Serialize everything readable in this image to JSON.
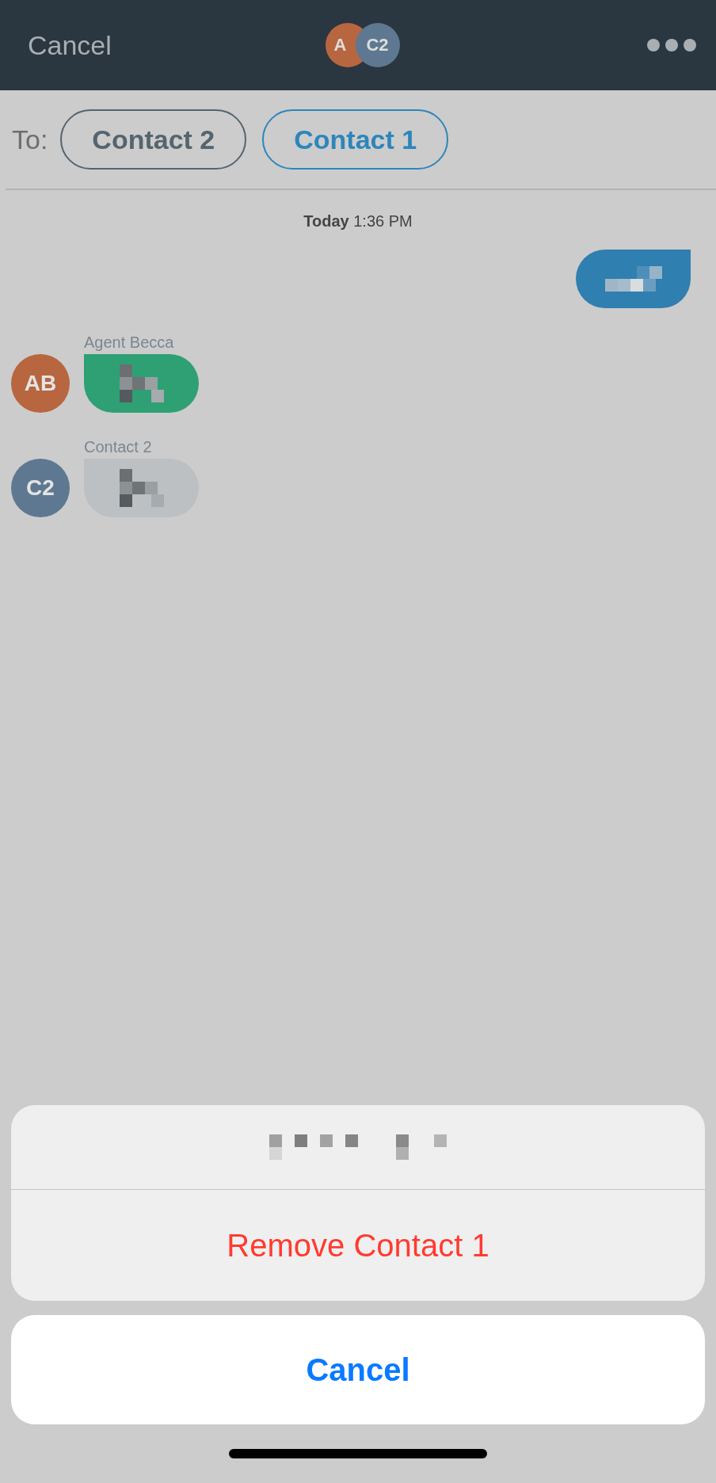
{
  "header": {
    "cancel": "Cancel",
    "avatars": [
      {
        "initials": "A",
        "color": "#b8663f"
      },
      {
        "initials": "C2",
        "color": "#5e7891"
      }
    ]
  },
  "recipients": {
    "label": "To:",
    "chips": [
      {
        "label": "Contact 2",
        "selected": false
      },
      {
        "label": "Contact 1",
        "selected": true
      }
    ]
  },
  "timestamp": "**Today** 1:36 PM",
  "messages": [
    {
      "kind": "outgoing"
    },
    {
      "kind": "incoming",
      "sender": "Agent Becca",
      "avatar": {
        "initials": "AB",
        "color": "#b8663f"
      },
      "bubble": {
        "color": "#2fa073"
      }
    },
    {
      "kind": "incoming",
      "sender": "Contact 2",
      "avatar": {
        "initials": "C2",
        "color": "#5e7891"
      },
      "bubble": {
        "color": "#bcc0c3"
      }
    }
  ],
  "action_sheet": {
    "actions": [
      {
        "label": "Remove Contact 1",
        "kind": "destructive"
      }
    ],
    "cancel": "Cancel"
  }
}
